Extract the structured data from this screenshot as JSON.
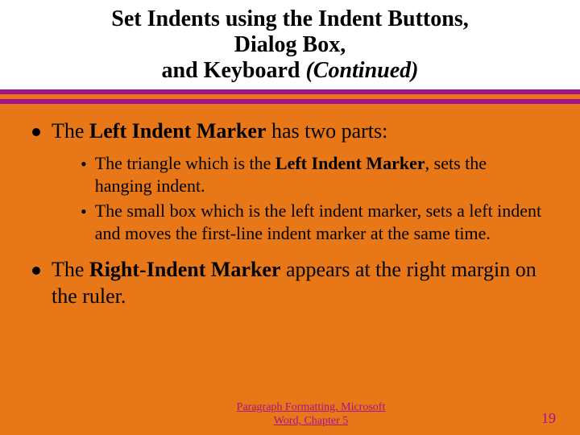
{
  "title": {
    "line1": "Set Indents using the Indent Buttons,",
    "line2": "Dialog Box,",
    "line3_pre": "and Keyboard ",
    "line3_italic": "(Continued)"
  },
  "bullets": {
    "b1_pre": "The ",
    "b1_bold": "Left Indent Marker",
    "b1_post": " has two parts:",
    "sub1_pre": "The triangle which is the ",
    "sub1_bold": "Left Indent Marker",
    "sub1_post": ", sets the hanging indent.",
    "sub2": "The small box which is the left indent marker, sets a left indent and moves the first-line indent marker at the same time.",
    "b2_pre": "The ",
    "b2_bold": "Right-Indent Marker",
    "b2_post": " appears at the right margin on the ruler."
  },
  "footer": {
    "center_line1": "Paragraph Formatting, Microsoft",
    "center_line2": "Word, Chapter 5",
    "page": "19"
  },
  "glyphs": {
    "sub_bullet": "•"
  }
}
